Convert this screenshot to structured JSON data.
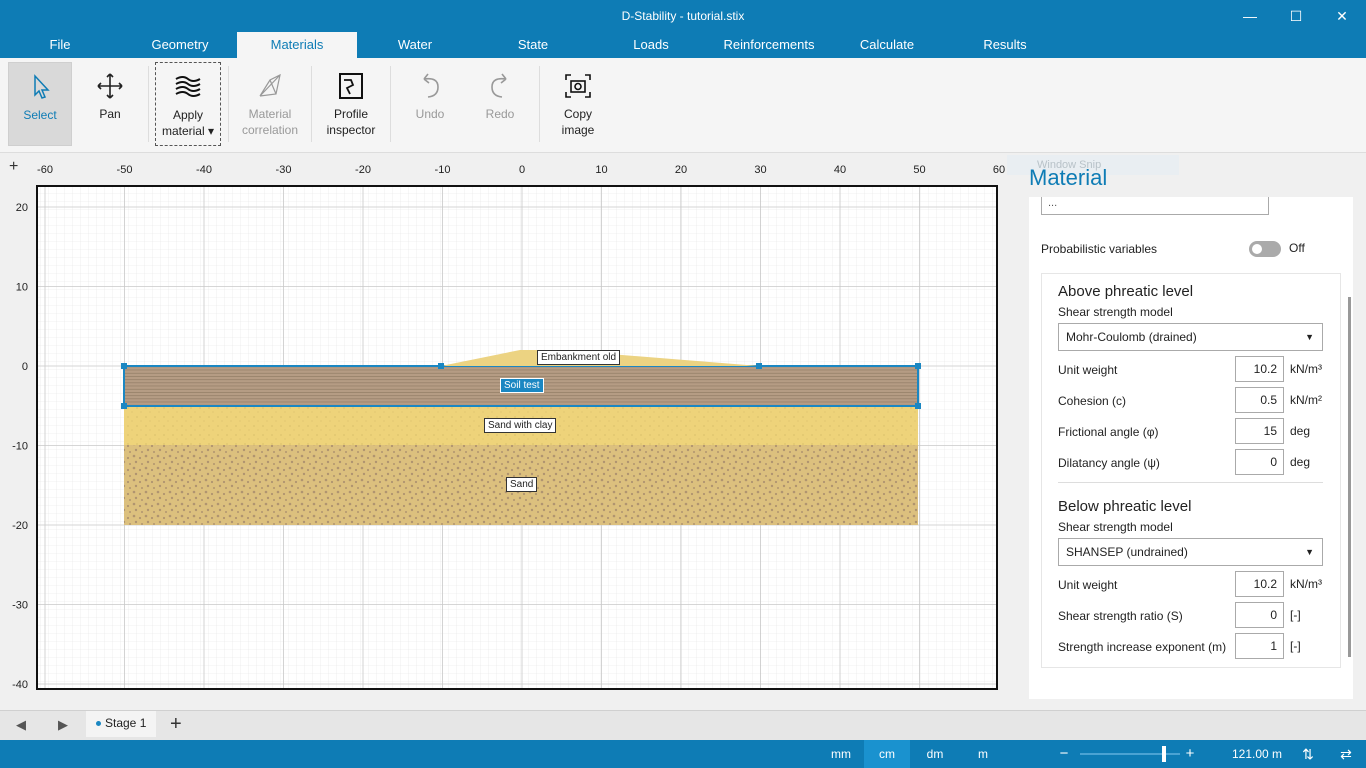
{
  "window": {
    "title": "D-Stability - tutorial.stix",
    "minimize": "—",
    "maximize": "☐",
    "close": "✕"
  },
  "menu": {
    "tabs": [
      "File",
      "Geometry",
      "Materials",
      "Water",
      "State",
      "Loads",
      "Reinforcements",
      "Calculate",
      "Results"
    ],
    "active": "Materials"
  },
  "ribbon": {
    "select": "Select",
    "pan": "Pan",
    "apply_material_1": "Apply",
    "apply_material_2": "material ▾",
    "material_correlation_1": "Material",
    "material_correlation_2": "correlation",
    "profile_inspector_1": "Profile",
    "profile_inspector_2": "inspector",
    "undo": "Undo",
    "redo": "Redo",
    "copy_image_1": "Copy",
    "copy_image_2": "image"
  },
  "ruler": {
    "plus": "+",
    "x_ticks": [
      "-60",
      "-50",
      "-40",
      "-30",
      "-20",
      "-10",
      "0",
      "10",
      "20",
      "30",
      "40",
      "50",
      "60"
    ],
    "y_ticks": [
      "20",
      "10",
      "0",
      "-10",
      "-20",
      "-30",
      "-40"
    ]
  },
  "layers": {
    "embankment": "Embankment old",
    "soil_test": "Soil test",
    "sand_with_clay": "Sand with clay",
    "sand": "Sand"
  },
  "window_snip": "Window Snip",
  "panel": {
    "title": "Material",
    "truncated_field": "...",
    "probabilistic_label": "Probabilistic variables",
    "probabilistic_state": "Off",
    "above": {
      "title": "Above phreatic level",
      "model_label": "Shear strength model",
      "model_value": "Mohr-Coulomb (drained)",
      "unit_weight_label": "Unit weight",
      "unit_weight_value": "10.2",
      "unit_weight_unit": "kN/m³",
      "cohesion_label": "Cohesion (c)",
      "cohesion_value": "0.5",
      "cohesion_unit": "kN/m²",
      "friction_label": "Frictional angle (φ)",
      "friction_value": "15",
      "friction_unit": "deg",
      "dilatancy_label": "Dilatancy angle (ψ)",
      "dilatancy_value": "0",
      "dilatancy_unit": "deg"
    },
    "below": {
      "title": "Below phreatic level",
      "model_label": "Shear strength model",
      "model_value": "SHANSEP (undrained)",
      "unit_weight_label": "Unit weight",
      "unit_weight_value": "10.2",
      "unit_weight_unit": "kN/m³",
      "ratio_label": "Shear strength ratio (S)",
      "ratio_value": "0",
      "ratio_unit": "[-]",
      "exponent_label": "Strength increase exponent (m)",
      "exponent_value": "1",
      "exponent_unit": "[-]"
    }
  },
  "stages": {
    "stage1": "Stage 1",
    "add": "+",
    "prev": "◀",
    "next": "▶"
  },
  "status": {
    "mm": "mm",
    "cm": "cm",
    "dm": "dm",
    "m": "m",
    "active_unit": "cm",
    "zoom_out": "−",
    "zoom_in": "+",
    "zoom_level": "121.00 m",
    "zoom_fraction": 0.82,
    "sort": "⇅",
    "swap": "⇄"
  },
  "colors": {
    "accent": "#0e7cb5",
    "embankment": "#ecd382",
    "soil_test": "#b59c84",
    "sand_with_clay": "#eed37a",
    "sand": "#dcc07e"
  }
}
